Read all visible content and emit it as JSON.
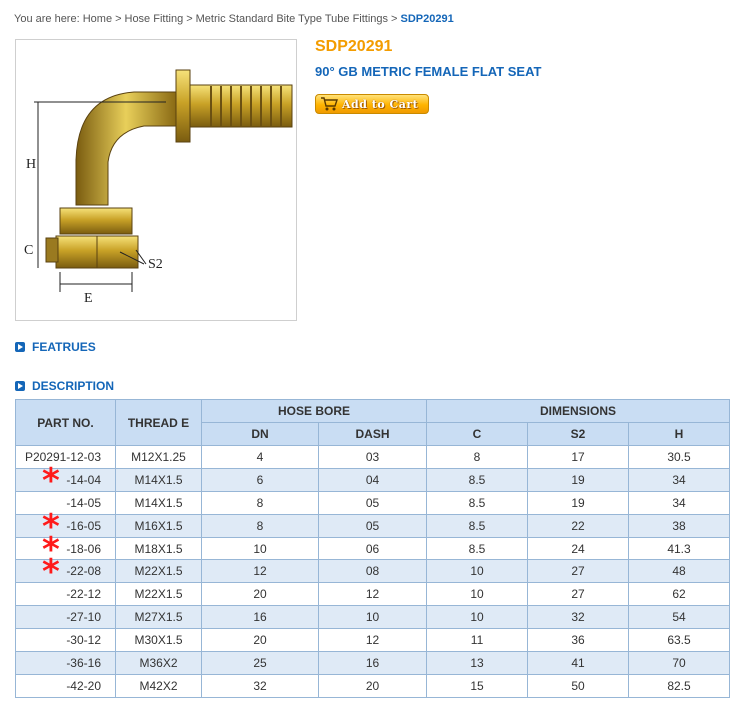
{
  "breadcrumb": {
    "prefix": "You are here:",
    "items": [
      "Home",
      "Hose Fitting",
      "Metric Standard Bite Type Tube Fittings"
    ],
    "current": "SDP20291"
  },
  "product": {
    "code": "SDP20291",
    "name": "90° GB METRIC FEMALE FLAT SEAT",
    "add_to_cart": "Add to Cart",
    "diagram_labels": {
      "h": "H",
      "c": "C",
      "e": "E",
      "s2": "S2"
    }
  },
  "sections": {
    "features": "FEATRUES",
    "description": "DESCRIPTION"
  },
  "table": {
    "headers": {
      "part_no": "PART NO.",
      "thread": "THREAD E",
      "hose_bore": "HOSE BORE",
      "dimensions": "DIMENSIONS",
      "dn": "DN",
      "dash": "DASH",
      "c": "C",
      "s2": "S2",
      "h": "H"
    },
    "rows": [
      {
        "part": "P20291-12-03",
        "thread": "M12X1.25",
        "dn": "4",
        "dash": "03",
        "c": "8",
        "s2": "17",
        "h": "30.5",
        "star": false
      },
      {
        "part": "-14-04",
        "thread": "M14X1.5",
        "dn": "6",
        "dash": "04",
        "c": "8.5",
        "s2": "19",
        "h": "34",
        "star": true
      },
      {
        "part": "-14-05",
        "thread": "M14X1.5",
        "dn": "8",
        "dash": "05",
        "c": "8.5",
        "s2": "19",
        "h": "34",
        "star": false
      },
      {
        "part": "-16-05",
        "thread": "M16X1.5",
        "dn": "8",
        "dash": "05",
        "c": "8.5",
        "s2": "22",
        "h": "38",
        "star": true
      },
      {
        "part": "-18-06",
        "thread": "M18X1.5",
        "dn": "10",
        "dash": "06",
        "c": "8.5",
        "s2": "24",
        "h": "41.3",
        "star": true
      },
      {
        "part": "-22-08",
        "thread": "M22X1.5",
        "dn": "12",
        "dash": "08",
        "c": "10",
        "s2": "27",
        "h": "48",
        "star": true
      },
      {
        "part": "-22-12",
        "thread": "M22X1.5",
        "dn": "20",
        "dash": "12",
        "c": "10",
        "s2": "27",
        "h": "62",
        "star": false
      },
      {
        "part": "-27-10",
        "thread": "M27X1.5",
        "dn": "16",
        "dash": "10",
        "c": "10",
        "s2": "32",
        "h": "54",
        "star": false
      },
      {
        "part": "-30-12",
        "thread": "M30X1.5",
        "dn": "20",
        "dash": "12",
        "c": "11",
        "s2": "36",
        "h": "63.5",
        "star": false
      },
      {
        "part": "-36-16",
        "thread": "M36X2",
        "dn": "25",
        "dash": "16",
        "c": "13",
        "s2": "41",
        "h": "70",
        "star": false
      },
      {
        "part": "-42-20",
        "thread": "M42X2",
        "dn": "32",
        "dash": "20",
        "c": "15",
        "s2": "50",
        "h": "82.5",
        "star": false
      }
    ]
  },
  "colors": {
    "link_blue": "#1466b8",
    "title_orange": "#f39c00",
    "header_bg": "#c9ddf3",
    "alt_row_bg": "#dfeaf6",
    "star_red": "#ff1a1a",
    "fitting_gold": "#c9a227"
  },
  "icons": {
    "section_bullet": "blue-square-arrow-icon",
    "cart": "shopping-cart-icon",
    "highlight": "red-asterisk-icon"
  }
}
